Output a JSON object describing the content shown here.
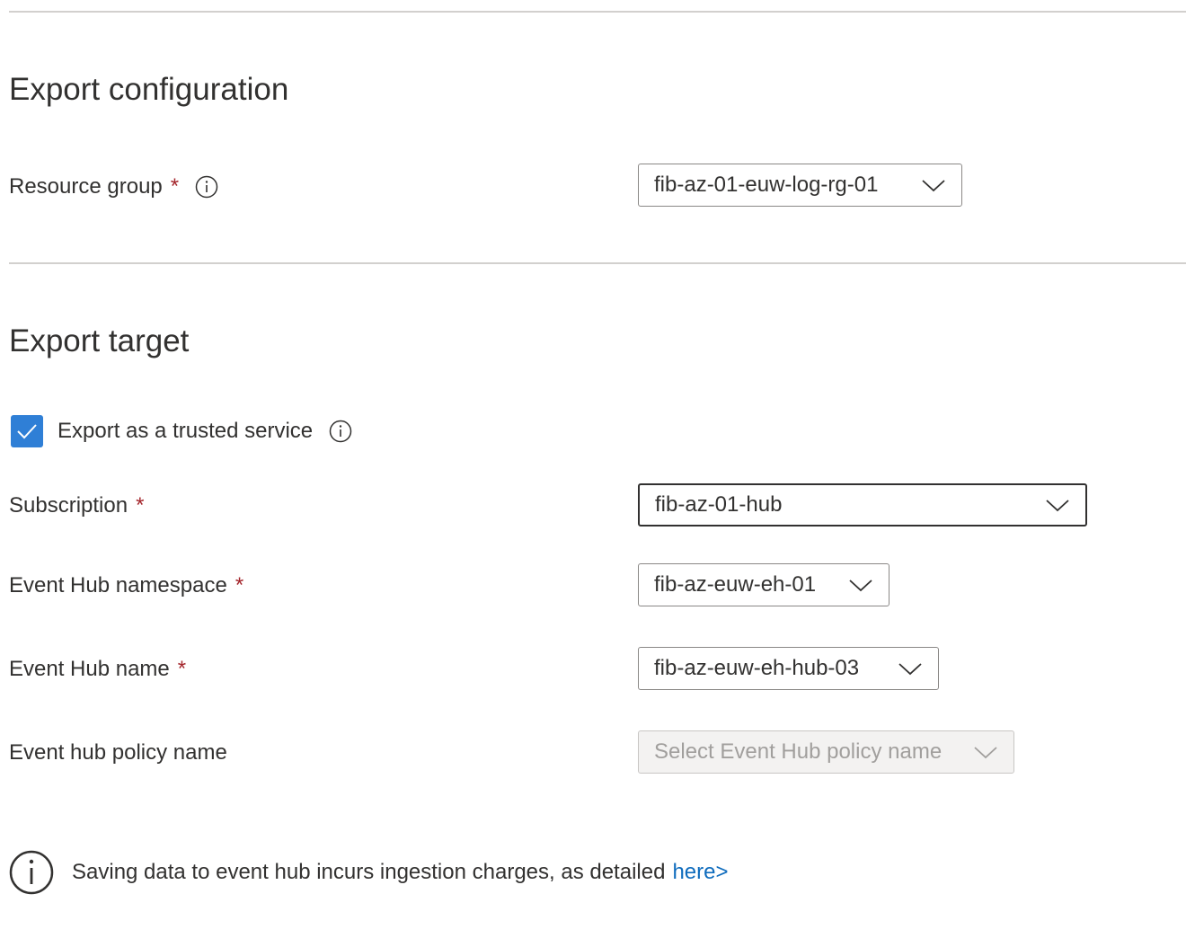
{
  "export_configuration": {
    "title": "Export configuration",
    "resource_group": {
      "label": "Resource group",
      "required_mark": "*",
      "value": "fib-az-01-euw-log-rg-01"
    }
  },
  "export_target": {
    "title": "Export target",
    "trusted_service": {
      "label": "Export as a trusted service",
      "checked": true
    },
    "subscription": {
      "label": "Subscription",
      "required_mark": "*",
      "value": "fib-az-01-hub"
    },
    "event_hub_namespace": {
      "label": "Event Hub namespace",
      "required_mark": "*",
      "value": "fib-az-euw-eh-01"
    },
    "event_hub_name": {
      "label": "Event Hub name",
      "required_mark": "*",
      "value": "fib-az-euw-eh-hub-03"
    },
    "event_hub_policy_name": {
      "label": "Event hub policy name",
      "placeholder": "Select Event Hub policy name"
    }
  },
  "notice": {
    "text": "Saving data to event hub incurs ingestion charges, as detailed",
    "link_text": "here>"
  },
  "colors": {
    "accent": "#2f7fd6",
    "link": "#0f6cbd",
    "required": "#a4262c",
    "divider": "#d2d0ce"
  },
  "icons": [
    "info-icon",
    "chevron-down-icon",
    "checkmark-icon",
    "info-circle-icon"
  ]
}
